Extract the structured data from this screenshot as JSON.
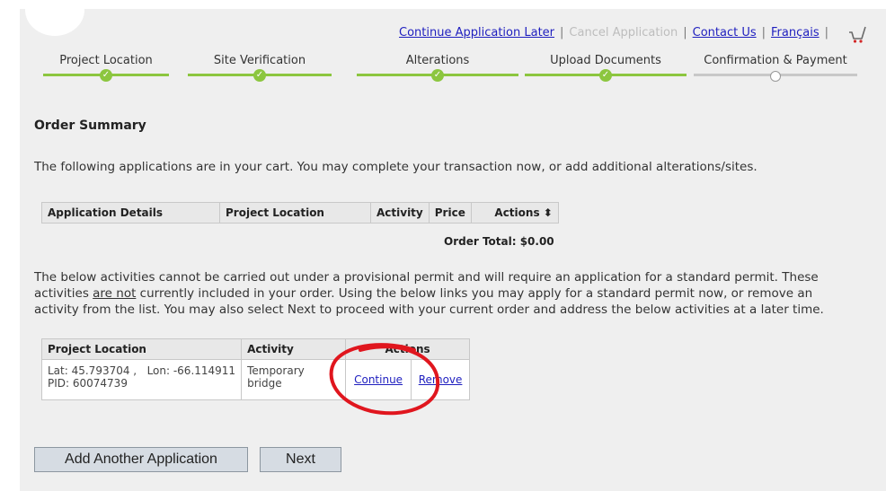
{
  "top_links": {
    "continue_later": "Continue Application Later",
    "cancel": "Cancel Application",
    "contact": "Contact Us",
    "language": "Français"
  },
  "steps": [
    {
      "label": "Project Location",
      "status": "complete"
    },
    {
      "label": "Site Verification",
      "status": "complete"
    },
    {
      "label": "Alterations",
      "status": "complete"
    },
    {
      "label": "Upload Documents",
      "status": "complete"
    },
    {
      "label": "Confirmation & Payment",
      "status": "current"
    }
  ],
  "order_summary": {
    "title": "Order Summary",
    "intro": "The following applications are in your cart. You may complete your transaction now, or add additional alterations/sites.",
    "columns": [
      "Application Details",
      "Project Location",
      "Activity",
      "Price",
      "Actions ⬍"
    ],
    "total": "Order Total: $0.00"
  },
  "notice": {
    "part1": "The below activities cannot be carried out under a provisional permit and will require an application for a standard permit. These activities ",
    "underlined": "are not",
    "part2": " currently included in your order. Using the below links you may apply for a standard permit now, or remove an activity from the list. You may also select Next to proceed with your current order and address the below activities at a later time."
  },
  "activities": {
    "columns": [
      "Project Location",
      "Activity",
      "Actions"
    ],
    "rows": [
      {
        "location_line1": "Lat: 45.793704 ,   Lon: -66.114911",
        "location_line2": "PID: 60074739",
        "activity": "Temporary bridge",
        "continue": "Continue",
        "remove": "Remove"
      }
    ]
  },
  "buttons": {
    "add_another": "Add Another Application",
    "next": "Next"
  },
  "colors": {
    "progress_complete": "#8cc63f",
    "progress_pending": "#c8c8c8",
    "link": "#1f1fbf",
    "annotation": "#e0161e"
  },
  "icons": [
    "cart-icon",
    "check-icon",
    "sort-icon"
  ]
}
